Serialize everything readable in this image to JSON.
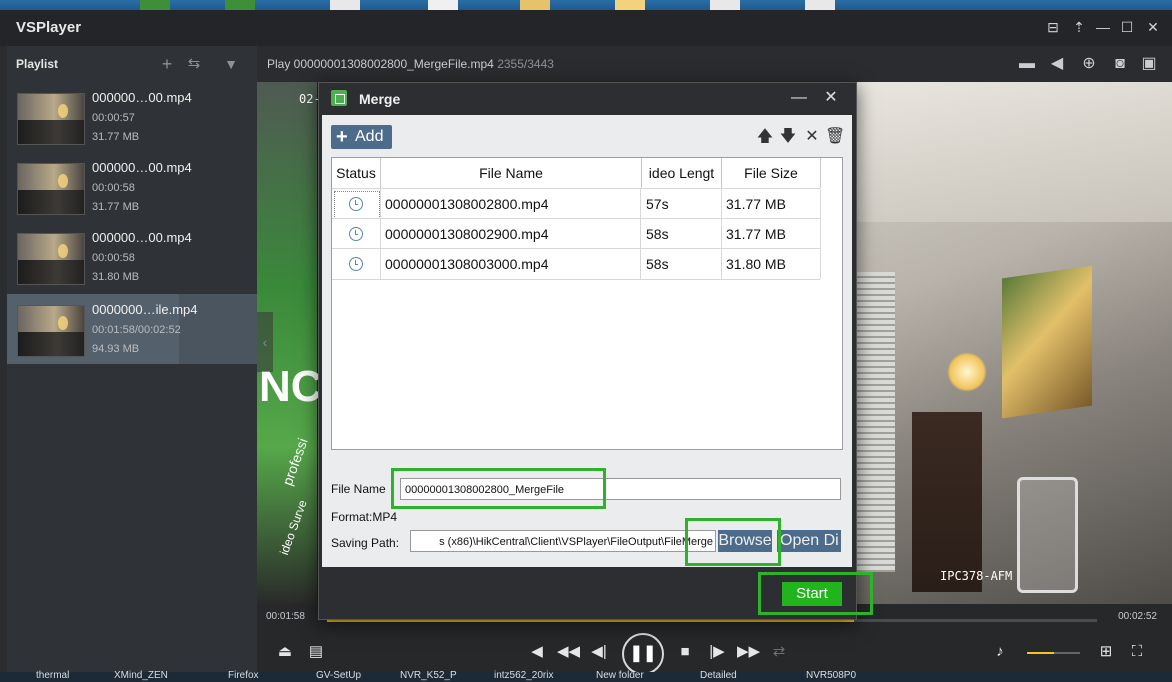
{
  "app": {
    "title": "VSPlayer"
  },
  "window_controls": {
    "icons": [
      "screen-icon",
      "pin-icon",
      "minimize-icon",
      "maximize-icon",
      "close-icon"
    ]
  },
  "playlist": {
    "title": "Playlist",
    "items": [
      {
        "name": "000000…00.mp4",
        "duration": "00:00:57",
        "size": "31.77 MB"
      },
      {
        "name": "000000…00.mp4",
        "duration": "00:00:58",
        "size": "31.77 MB"
      },
      {
        "name": "000000…00.mp4",
        "duration": "00:00:58",
        "size": "31.80 MB"
      },
      {
        "name": "0000000…ile.mp4",
        "duration": "00:01:58/00:02:52",
        "size": "94.93 MB",
        "active": true
      }
    ]
  },
  "player": {
    "play_title": "Play 00000001308002800_MergeFile.mp4",
    "frames": "2355/3443",
    "video_date": "02-",
    "video_camera": "IPC378-AFM",
    "video_text_left": "NC",
    "video_text_prof": "professi",
    "video_text_video": "ideo Surve",
    "time_current": "00:01:58",
    "time_total": "00:02:52",
    "progress": 0.685,
    "volume": 0.5
  },
  "merge_dialog": {
    "title": "Merge",
    "add_label": "Add",
    "columns": [
      "Status",
      "File Name",
      "ideo Lengt",
      "File Size"
    ],
    "rows": [
      {
        "file_name": "00000001308002800.mp4",
        "length": "57s",
        "size": "31.77 MB"
      },
      {
        "file_name": "00000001308002900.mp4",
        "length": "58s",
        "size": "31.77 MB"
      },
      {
        "file_name": "00000001308003000.mp4",
        "length": "58s",
        "size": "31.80 MB"
      }
    ],
    "file_name_label": "File Name",
    "file_name_value": "00000001308002800_MergeFile",
    "format_label": "Format:MP4",
    "saving_path_label": "Saving Path:",
    "saving_path_value": "s (x86)\\HikCentral\\Client\\VSPlayer\\FileOutput\\FileMerge",
    "browse_label": "Browse",
    "open_dir_label": "Open Di",
    "start_label": "Start"
  },
  "taskbar": {
    "items": [
      "thermal",
      "XMind_ZEN",
      "Firefox",
      "GV-SetUp",
      "NVR_K52_P",
      "intz562_20rix",
      "New folder",
      "Detailed",
      "NVR508P0"
    ]
  },
  "desktop_left": "t"
}
